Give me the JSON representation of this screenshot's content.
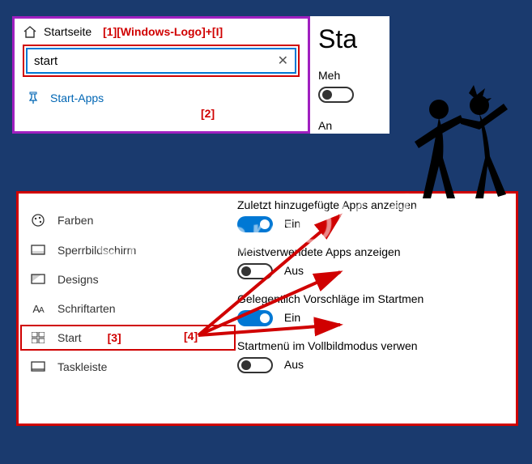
{
  "panel1": {
    "breadcrumb_label": "Startseite",
    "annotation1": "[1][Windows-Logo]+[I]",
    "search_value": "start",
    "suggestion_label": "Start-Apps",
    "annotation2": "[2]"
  },
  "rightpeek": {
    "heading_partial": "Sta",
    "setting_label_partial": "Meh",
    "extra_partial": "An"
  },
  "sidebar": {
    "items": [
      {
        "icon": "palette-icon",
        "label": "Farben"
      },
      {
        "icon": "lockscreen-icon",
        "label": "Sperrbildschirm"
      },
      {
        "icon": "designs-icon",
        "label": "Designs"
      },
      {
        "icon": "fonts-icon",
        "label": "Schriftarten"
      },
      {
        "icon": "start-icon",
        "label": "Start"
      },
      {
        "icon": "taskbar-icon",
        "label": "Taskleiste"
      }
    ],
    "annotation3": "[3]",
    "annotation4": "[4]"
  },
  "settings": [
    {
      "label": "Zuletzt hinzugefügte Apps anzeigen",
      "on": true,
      "state": "Ein"
    },
    {
      "label": "Meistverwendete Apps anzeigen",
      "on": false,
      "state": "Aus"
    },
    {
      "label": "Gelegentlich Vorschläge im Startmen",
      "on": true,
      "state": "Ein"
    },
    {
      "label": "Startmenü im Vollbildmodus verwen",
      "on": false,
      "state": "Aus"
    }
  ],
  "watermark": "SoftwareOK.de"
}
